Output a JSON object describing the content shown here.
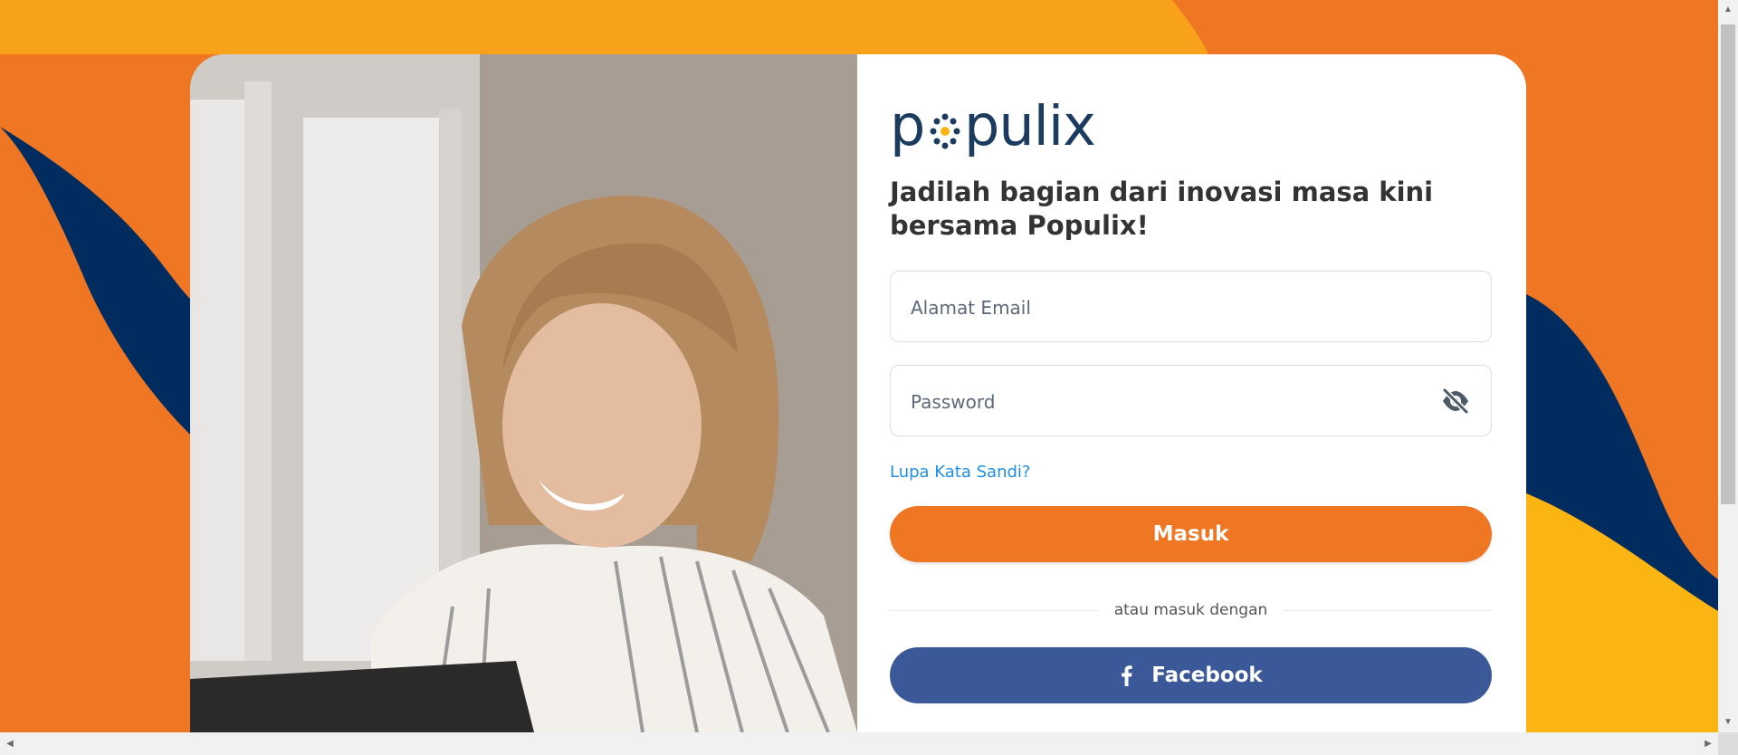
{
  "brand": {
    "name": "populix",
    "primary": "#ef7622",
    "navy": "#002c5f",
    "yellow": "#fbb512"
  },
  "headline": "Jadilah bagian dari inovasi masa kini bersama Populix!",
  "form": {
    "email_placeholder": "Alamat Email",
    "password_placeholder": "Password",
    "toggle_icon": "eye-slash-icon",
    "forgot_label": "Lupa Kata Sandi?",
    "login_label": "Masuk",
    "divider_text": "atau masuk dengan",
    "facebook_label": "Facebook",
    "facebook_color": "#3b5998"
  }
}
